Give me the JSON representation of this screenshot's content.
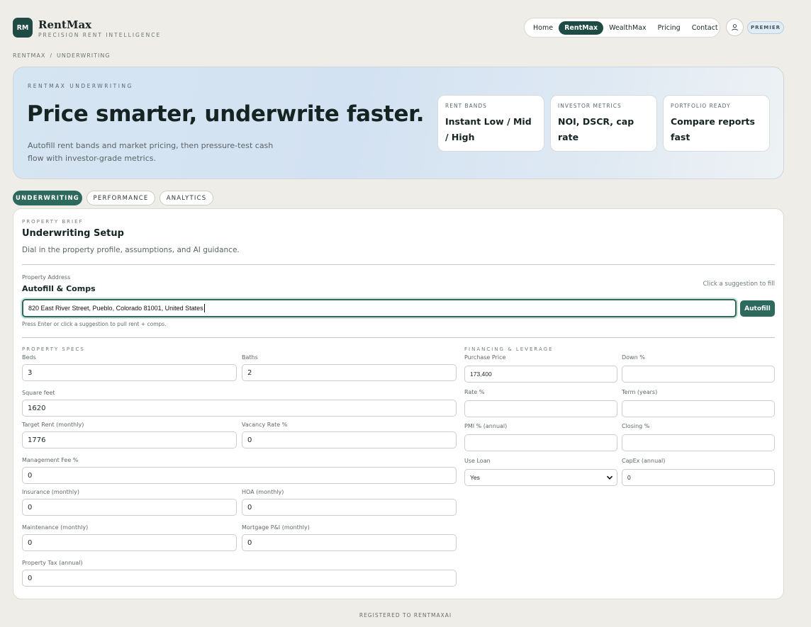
{
  "brand": {
    "logo": "RM",
    "name": "RentMax",
    "tagline": "PRECISION RENT INTELLIGENCE"
  },
  "nav": {
    "items": [
      {
        "label": "Home",
        "active": false
      },
      {
        "label": "RentMax",
        "active": true
      },
      {
        "label": "WealthMax",
        "active": false
      },
      {
        "label": "Pricing",
        "active": false
      },
      {
        "label": "Contact",
        "active": false
      }
    ],
    "user_icon": "user-icon",
    "badge": "PREMIER"
  },
  "breadcrumb": [
    "RENTMAX",
    "/",
    "UNDERWRITING"
  ],
  "hero": {
    "kicker": "RENTMAX UNDERWRITING",
    "title": "Price smarter, underwrite faster.",
    "subtitle": "Autofill rent bands and market pricing, then pressure-test cash flow with investor-grade metrics.",
    "cards": [
      {
        "label": "RENT BANDS",
        "value": "Instant Low / Mid / High"
      },
      {
        "label": "INVESTOR METRICS",
        "value": "NOI, DSCR, cap rate"
      },
      {
        "label": "PORTFOLIO READY",
        "value": "Compare reports fast"
      }
    ]
  },
  "tabs": [
    {
      "label": "UNDERWRITING",
      "active": true
    },
    {
      "label": "PERFORMANCE",
      "active": false
    },
    {
      "label": "ANALYTICS",
      "active": false
    }
  ],
  "panel": {
    "kicker": "PROPERTY BRIEF",
    "title": "Underwriting Setup",
    "description": "Dial in the property profile, assumptions, and AI guidance.",
    "address": {
      "label": "Property Address",
      "section_title": "Autofill & Comps",
      "hint": "Click a suggestion to fill",
      "value": "820 East River Street, Pueblo, Colorado 81001, United States",
      "button": "Autofill",
      "help": "Press Enter or click a suggestion to pull rent + comps."
    },
    "specs": {
      "kicker": "PROPERTY SPECS",
      "beds": {
        "label": "Beds",
        "value": "3"
      },
      "baths": {
        "label": "Baths",
        "value": "2"
      },
      "sqft": {
        "label": "Square feet",
        "value": "1620"
      },
      "target_rent": {
        "label": "Target Rent (monthly)",
        "value": "1776"
      },
      "vacancy": {
        "label": "Vacancy Rate %",
        "value": "0"
      },
      "mgmt_fee": {
        "label": "Management Fee %",
        "value": "0"
      },
      "insurance": {
        "label": "Insurance (monthly)",
        "value": "0"
      },
      "hoa": {
        "label": "HOA (monthly)",
        "value": "0"
      },
      "maintenance": {
        "label": "Maintenance (monthly)",
        "value": "0"
      },
      "mortgage_pi": {
        "label": "Mortgage P&I (monthly)",
        "value": "0"
      },
      "property_tax": {
        "label": "Property Tax (annual)",
        "value": "0"
      }
    },
    "financing": {
      "kicker": "FINANCING & LEVERAGE",
      "purchase_price": {
        "label": "Purchase Price",
        "value": "173,400"
      },
      "down": {
        "label": "Down %",
        "value": ""
      },
      "rate": {
        "label": "Rate %",
        "value": ""
      },
      "term": {
        "label": "Term (years)",
        "value": ""
      },
      "pmi": {
        "label": "PMI % (annual)",
        "value": ""
      },
      "closing": {
        "label": "Closing %",
        "value": ""
      },
      "use_loan": {
        "label": "Use Loan",
        "value": "Yes"
      },
      "capex": {
        "label": "CapEx (annual)",
        "value": "0"
      }
    }
  },
  "footer": "REGISTERED TO RENTMAXAI",
  "colors": {
    "accent": "#2d6a5d",
    "brand_dark": "#1f4b45",
    "background": "#efede7"
  }
}
